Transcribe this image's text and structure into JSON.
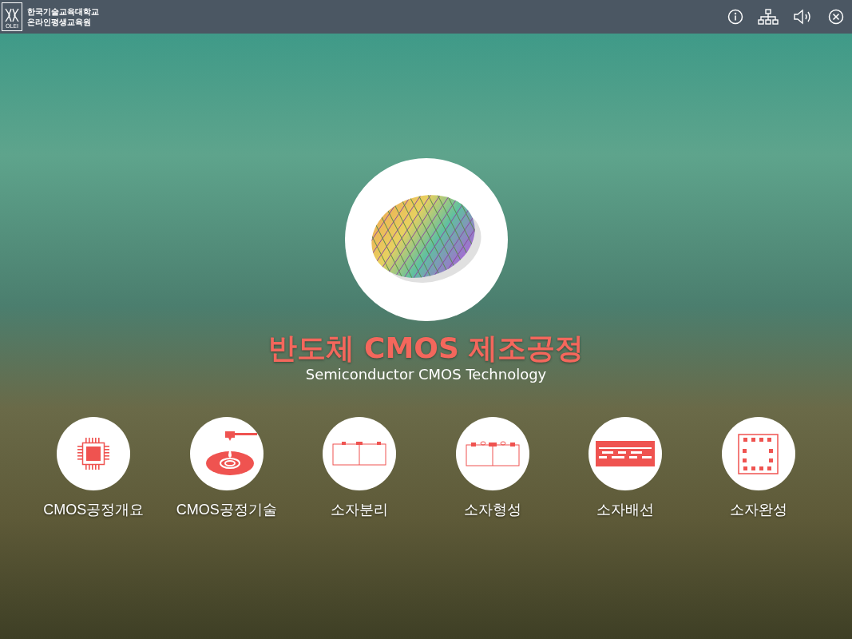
{
  "header": {
    "logo_text": "OLEI",
    "org_line_1": "한국기술교육대학교",
    "org_line_2": "온라인평생교육원"
  },
  "title": "반도체 CMOS 제조공정",
  "subtitle": "Semiconductor CMOS Technology",
  "menu": [
    {
      "label": "CMOS공정개요",
      "kind": "chip"
    },
    {
      "label": "CMOS공정기술",
      "kind": "dropper"
    },
    {
      "label": "소자분리",
      "kind": "isolation"
    },
    {
      "label": "소자형성",
      "kind": "formation"
    },
    {
      "label": "소자배선",
      "kind": "wiring"
    },
    {
      "label": "소자완성",
      "kind": "complete"
    }
  ]
}
